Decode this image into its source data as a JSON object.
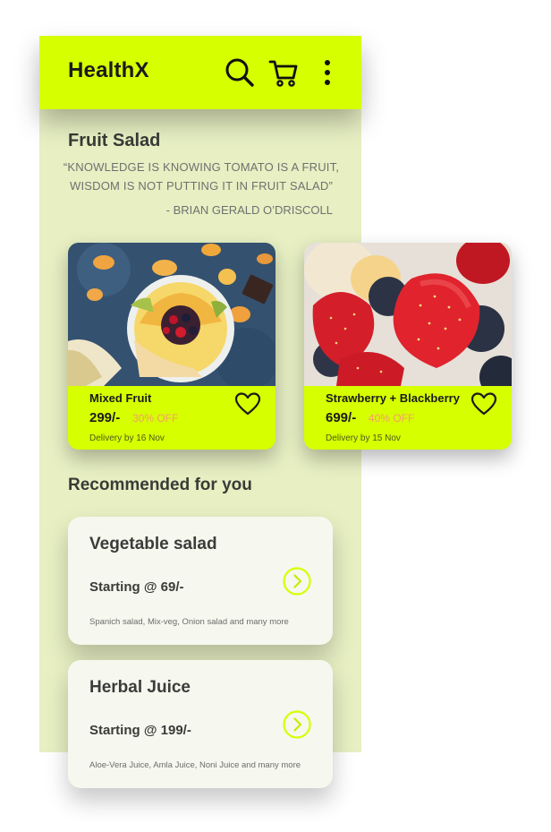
{
  "header": {
    "brand": "HealthX",
    "accent_color": "#d6ff00",
    "icons": [
      "search-icon",
      "cart-icon",
      "more-vertical-icon"
    ]
  },
  "intro": {
    "title": "Fruit Salad",
    "quote": "“KNOWLEDGE IS KNOWING TOMATO IS A FRUIT, WISDOM IS NOT PUTTING IT IN FRUIT SALAD”",
    "author": "- BRIAN GERALD O’DRISCOLL"
  },
  "products": [
    {
      "name": "Mixed Fruit",
      "price": "299/-",
      "discount": "30% OFF",
      "delivery": "Delivery by 16 Nov",
      "image": "mixed-fruit-bowl-photo"
    },
    {
      "name": "Strawberry + Blackberry",
      "price": "699/-",
      "discount": "40% OFF",
      "delivery": "Delivery by 15 Nov",
      "image": "strawberry-blackberry-photo"
    }
  ],
  "recommended": {
    "title": "Recommended for you",
    "items": [
      {
        "name": "Vegetable salad",
        "price": "Starting @ 69/-",
        "description": "Spanich salad, Mix-veg, Onion salad and many more"
      },
      {
        "name": "Herbal Juice",
        "price": "Starting @ 199/-",
        "description": "Aloe-Vera Juice, Amla Juice, Noni Juice and many more"
      }
    ]
  }
}
